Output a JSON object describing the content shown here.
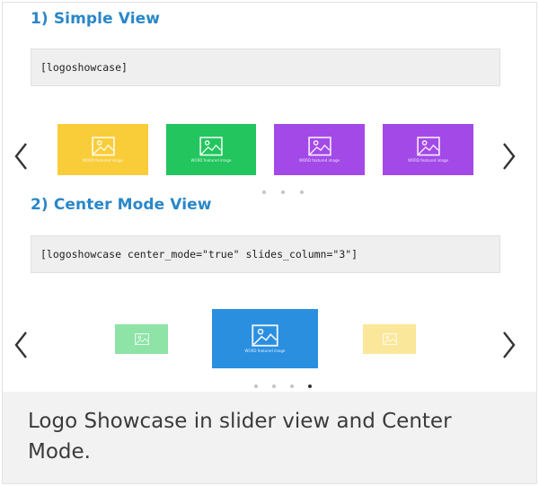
{
  "simple_view": {
    "title": "1) Simple View",
    "shortcode": "[logoshowcase]",
    "tiles": [
      {
        "color": "#f9cd3a",
        "caption": "WORD featured image"
      },
      {
        "color": "#22c55e",
        "caption": "WORD featured image"
      },
      {
        "color": "#a349e8",
        "caption": "WORD featured image"
      },
      {
        "color": "#a349e8",
        "caption": "WORD featured image"
      }
    ],
    "dots": 3,
    "active_dot": -1
  },
  "center_mode_view": {
    "title": "2) Center Mode View",
    "shortcode": "[logoshowcase center_mode=\"true\" slides_column=\"3\"]",
    "tiles": [
      {
        "color": "#8ee3a6",
        "caption": ""
      },
      {
        "color": "#2b8fe0",
        "caption": "WORD featured image"
      },
      {
        "color": "#fbe79a",
        "caption": ""
      }
    ],
    "dots": 4,
    "active_dot": 3
  },
  "caption": "Logo Showcase in slider view and Center Mode.",
  "icons": {
    "prev": "chevron-left-icon",
    "next": "chevron-right-icon",
    "placeholder": "image-icon"
  }
}
